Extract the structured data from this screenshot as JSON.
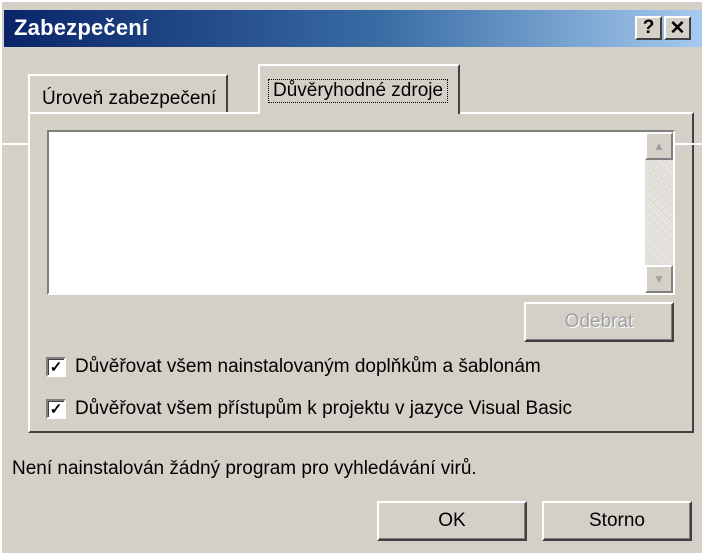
{
  "window": {
    "title": "Zabezpečení",
    "help_label": "?",
    "close_label": "✕"
  },
  "tabs": [
    {
      "label": "Úroveň zabezpečení",
      "active": false
    },
    {
      "label": "Důvěryhodné zdroje",
      "active": true
    }
  ],
  "trusted_sources": {
    "list_items": [],
    "remove_button_label": "Odebrat",
    "remove_button_enabled": false
  },
  "options": [
    {
      "label": "Důvěřovat všem nainstalovaným doplňkům a šablonám",
      "checked": true
    },
    {
      "label": "Důvěřovat všem přístupům k projektu v jazyce Visual Basic",
      "checked": true
    }
  ],
  "status_text": "Není nainstalován žádný program pro vyhledávání virů.",
  "buttons": {
    "ok_label": "OK",
    "cancel_label": "Storno"
  },
  "icons": {
    "scroll_up": "triangle-up-icon",
    "scroll_down": "triangle-down-icon",
    "check": "check-mark-icon"
  }
}
